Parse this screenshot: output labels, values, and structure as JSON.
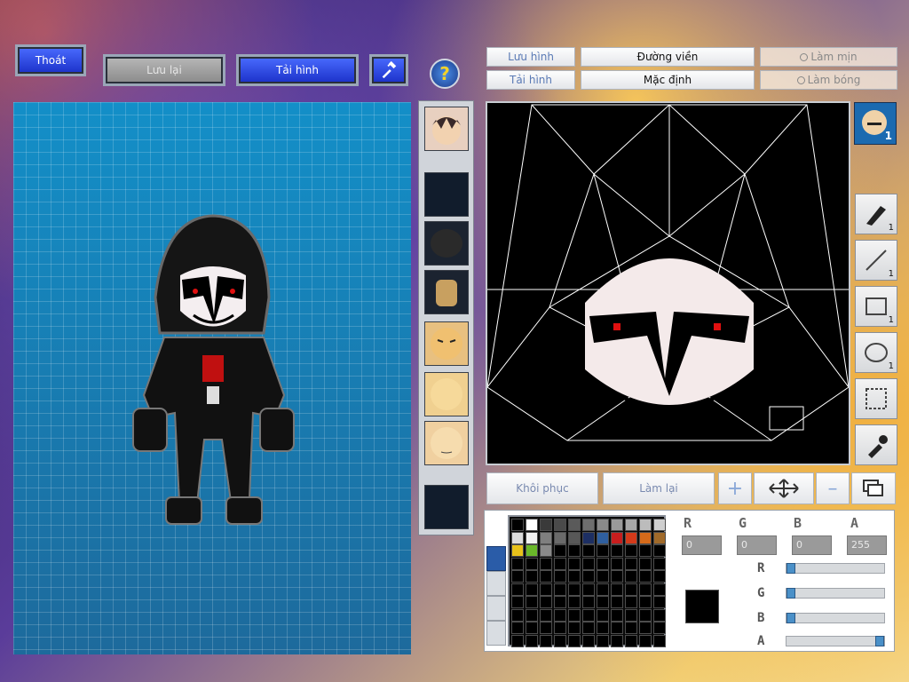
{
  "top_left": {
    "exit_label": "Thoát",
    "save_label": "Lưu lại",
    "reload_label": "Tải hình"
  },
  "editor_top": {
    "save_img_label": "Lưu hình",
    "reload_img_label": "Tải hình",
    "outline_label": "Đường viền",
    "default_label": "Mặc định",
    "smooth_label": "Làm mịn",
    "shine_label": "Làm bóng"
  },
  "head_badge": "1",
  "tools": [
    {
      "name": "pen-tool",
      "count": "1"
    },
    {
      "name": "line-tool",
      "count": "1"
    },
    {
      "name": "rect-tool",
      "count": "1"
    },
    {
      "name": "ellipse-tool",
      "count": "1"
    },
    {
      "name": "select-tool",
      "count": ""
    },
    {
      "name": "eyedropper-tool",
      "count": ""
    }
  ],
  "actions": {
    "restore_label": "Khôi phục",
    "redo_label": "Làm lại"
  },
  "color": {
    "r_label": "R",
    "g_label": "G",
    "b_label": "B",
    "a_label": "A",
    "r_value": "0",
    "g_value": "0",
    "b_value": "0",
    "a_value": "255",
    "current": "#000000",
    "sliders": {
      "r": 0,
      "g": 0,
      "b": 0,
      "a": 255
    }
  },
  "palette": [
    "#000000",
    "#ffffff",
    "#3a3a3a",
    "#4a4a4a",
    "#5a5a5a",
    "#6e6e6e",
    "#8a8a8a",
    "#9a9a9a",
    "#a8a8a8",
    "#bcbcbc",
    "#cfcfcf",
    "#dcdcdc",
    "#f2f2f2",
    "#7f7f7f",
    "#6a6a6a",
    "#585858",
    "#1d2f63",
    "#2f5f9f",
    "#c81e1e",
    "#d43a1a",
    "#d56a1a",
    "#a06a2a",
    "#e8c21a",
    "#6ab82a",
    "#8a8a8a"
  ],
  "colors": {
    "accent_blue": "#1b30c8",
    "grid_bg": "#1e86b8"
  }
}
